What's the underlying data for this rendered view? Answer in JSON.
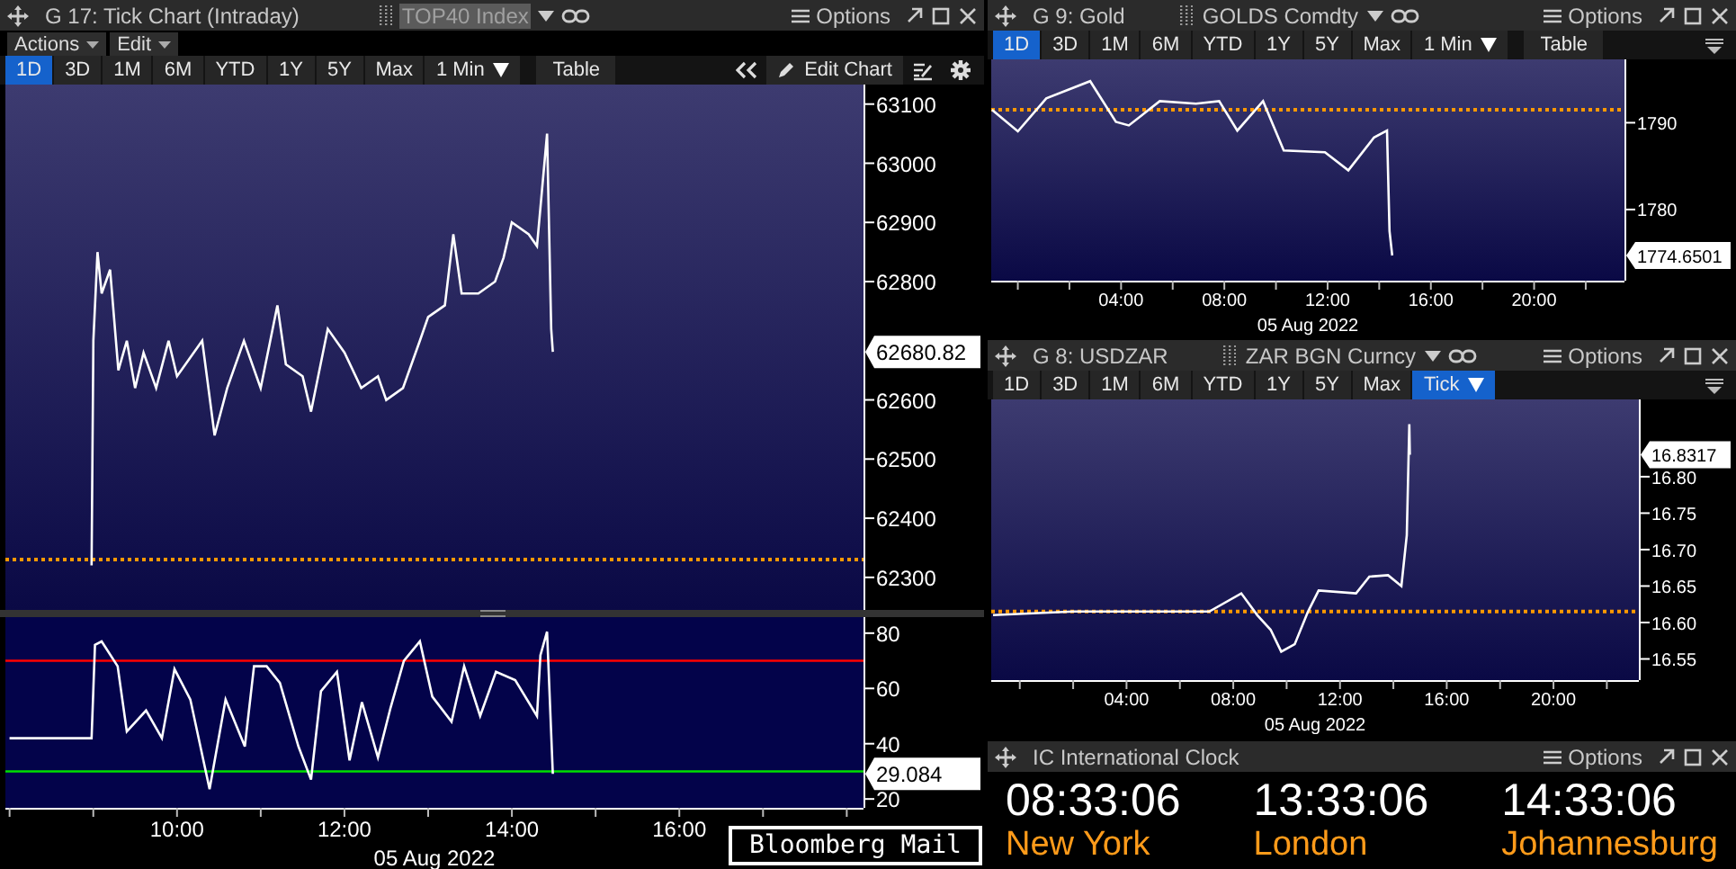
{
  "left_panel": {
    "title": "G 17: Tick Chart (Intraday)",
    "security": {
      "label": "TOP40 Index",
      "selected": true
    },
    "options": "Options",
    "menus": [
      {
        "label": "Actions"
      },
      {
        "label": "Edit"
      }
    ],
    "controls": [
      {
        "kind": "range",
        "label": "1D",
        "selected": true
      },
      {
        "kind": "range",
        "label": "3D",
        "selected": false
      },
      {
        "kind": "range",
        "label": "1M",
        "selected": false
      },
      {
        "kind": "range",
        "label": "6M",
        "selected": false
      },
      {
        "kind": "range",
        "label": "YTD",
        "selected": false
      },
      {
        "kind": "range",
        "label": "1Y",
        "selected": false
      },
      {
        "kind": "range",
        "label": "5Y",
        "selected": false
      },
      {
        "kind": "range",
        "label": "Max",
        "selected": false
      },
      {
        "kind": "interval",
        "label": "1 Min",
        "selected": false
      },
      {
        "kind": "button",
        "label": "Table",
        "selected": false
      }
    ],
    "edit_chart": "Edit Chart",
    "price_chart": {
      "chart_data": {
        "type": "line",
        "x": [
          8.98,
          9.0,
          9.05,
          9.1,
          9.2,
          9.3,
          9.4,
          9.5,
          9.6,
          9.75,
          9.9,
          10.0,
          10.1,
          10.3,
          10.45,
          10.6,
          10.8,
          11.0,
          11.2,
          11.3,
          11.5,
          11.6,
          11.8,
          12.0,
          12.2,
          12.4,
          12.5,
          12.7,
          12.9,
          13.0,
          13.2,
          13.3,
          13.4,
          13.6,
          13.8,
          13.9,
          14.0,
          14.2,
          14.3,
          14.42,
          14.47,
          14.49
        ],
        "series": [
          {
            "color": "#ffffff",
            "values": [
              62320,
              62700,
              62850,
              62780,
              62820,
              62650,
              62700,
              62620,
              62680,
              62620,
              62700,
              62640,
              62660,
              62700,
              62540,
              62620,
              62700,
              62620,
              62760,
              62660,
              62640,
              62580,
              62720,
              62680,
              62620,
              62640,
              62600,
              62620,
              62700,
              62740,
              62760,
              62880,
              62780,
              62780,
              62800,
              62840,
              62900,
              62880,
              62860,
              63050,
              62720,
              62681
            ]
          }
        ],
        "xlim": [
          7.95,
          18.2
        ],
        "ylim": [
          62245,
          63133
        ],
        "yticks": [
          62300,
          62400,
          62500,
          62600,
          62800,
          62900,
          63000,
          63100
        ],
        "ref_lines": [
          {
            "axis": "y",
            "value": 62330,
            "color": "#ff9900"
          }
        ]
      },
      "last_price": "62680.82"
    },
    "indicator_chart": {
      "chart_data": {
        "type": "line",
        "x": [
          8.0,
          8.98,
          9.02,
          9.1,
          9.29,
          9.4,
          9.63,
          9.82,
          9.97,
          10.16,
          10.39,
          10.58,
          10.81,
          10.92,
          11.07,
          11.23,
          11.45,
          11.6,
          11.72,
          11.91,
          12.06,
          12.21,
          12.4,
          12.55,
          12.71,
          12.9,
          13.05,
          13.28,
          13.43,
          13.62,
          13.81,
          14.04,
          14.3,
          14.34,
          14.42,
          14.49
        ],
        "series": [
          {
            "color": "#ffffff",
            "values": [
              42,
              42,
              75.8,
              77,
              68,
              44.4,
              52,
              42,
              67,
              56,
              23.6,
              56,
              39,
              68,
              68,
              62,
              39,
              27,
              59,
              66,
              34,
              55,
              35,
              53,
              70,
              77,
              57,
              48,
              68,
              50,
              66,
              63,
              50,
              72,
              80.5,
              29.1
            ]
          }
        ],
        "xlim": [
          7.95,
          18.2
        ],
        "ylim": [
          16.8,
          85.8
        ],
        "yticks": [
          20,
          40,
          60,
          80
        ],
        "xlabel": "05 Aug 2022",
        "xticks": [
          {
            "value": 10,
            "label": "10:00"
          },
          {
            "value": 12,
            "label": "12:00"
          },
          {
            "value": 14,
            "label": "14:00"
          },
          {
            "value": 16,
            "label": "16:00"
          }
        ],
        "ref_lines": [
          {
            "axis": "y",
            "value": 70,
            "color": "#ff0000"
          },
          {
            "axis": "y",
            "value": 30,
            "color": "#00e000"
          }
        ]
      },
      "last_price": "29.084"
    },
    "footer_button": "Bloomberg Mail"
  },
  "gold_panel": {
    "title": "G 9: Gold",
    "security": {
      "label": "GOLDS Comdty",
      "selected": false
    },
    "options": "Options",
    "controls": [
      {
        "kind": "range",
        "label": "1D",
        "selected": true
      },
      {
        "kind": "range",
        "label": "3D",
        "selected": false
      },
      {
        "kind": "range",
        "label": "1M",
        "selected": false
      },
      {
        "kind": "range",
        "label": "6M",
        "selected": false
      },
      {
        "kind": "range",
        "label": "YTD",
        "selected": false
      },
      {
        "kind": "range",
        "label": "1Y",
        "selected": false
      },
      {
        "kind": "range",
        "label": "5Y",
        "selected": false
      },
      {
        "kind": "range",
        "label": "Max",
        "selected": false
      },
      {
        "kind": "interval",
        "label": "1 Min",
        "selected": false
      },
      {
        "kind": "button",
        "label": "Table",
        "selected": false
      }
    ],
    "chart_data": {
      "type": "line",
      "x": [
        -1.0,
        0.0,
        1.1,
        2.8,
        3.8,
        4.3,
        5.5,
        6.9,
        7.8,
        8.5,
        9.5,
        10.3,
        11.9,
        12.8,
        13.8,
        14.3,
        14.4,
        14.5
      ],
      "series": [
        {
          "color": "#ffffff",
          "values": [
            1791.5,
            1789,
            1792.8,
            1794.8,
            1790.1,
            1789.7,
            1792.5,
            1792.2,
            1792.5,
            1789.1,
            1792.5,
            1786.8,
            1786.6,
            1784.5,
            1788.3,
            1789.1,
            1777.5,
            1774.7
          ]
        }
      ],
      "xlim": [
        -1.03,
        23.5
      ],
      "ylim": [
        1771.8,
        1797.3
      ],
      "yticks": [
        1780,
        1790
      ],
      "xlabel": "05 Aug 2022",
      "xticks": [
        {
          "value": 4,
          "label": "04:00"
        },
        {
          "value": 8,
          "label": "08:00"
        },
        {
          "value": 12,
          "label": "12:00"
        },
        {
          "value": 16,
          "label": "16:00"
        },
        {
          "value": 20,
          "label": "20:00"
        }
      ],
      "ref_lines": [
        {
          "axis": "y",
          "value": 1791.5,
          "color": "#ff9900"
        }
      ]
    },
    "last_price": "1774.6501"
  },
  "usdzar_panel": {
    "title": "G 8: USDZAR",
    "security": {
      "label": "ZAR BGN Curncy",
      "selected": false
    },
    "options": "Options",
    "controls": [
      {
        "kind": "range",
        "label": "1D",
        "selected": false
      },
      {
        "kind": "range",
        "label": "3D",
        "selected": false
      },
      {
        "kind": "range",
        "label": "1M",
        "selected": false
      },
      {
        "kind": "range",
        "label": "6M",
        "selected": false
      },
      {
        "kind": "range",
        "label": "YTD",
        "selected": false
      },
      {
        "kind": "range",
        "label": "1Y",
        "selected": false
      },
      {
        "kind": "range",
        "label": "5Y",
        "selected": false
      },
      {
        "kind": "range",
        "label": "Max",
        "selected": false
      },
      {
        "kind": "interval",
        "label": "Tick",
        "selected": true
      }
    ],
    "chart_data": {
      "type": "line",
      "x": [
        -1.0,
        2.0,
        4.9,
        7.1,
        8.3,
        8.9,
        9.4,
        9.8,
        10.3,
        10.8,
        11.2,
        12.6,
        13.1,
        13.8,
        14.3,
        14.5,
        14.6,
        14.62
      ],
      "series": [
        {
          "color": "#ffffff",
          "values": [
            16.61,
            16.615,
            16.615,
            16.615,
            16.64,
            16.61,
            16.59,
            16.56,
            16.57,
            16.615,
            16.644,
            16.64,
            16.663,
            16.665,
            16.65,
            16.72,
            16.872,
            16.83
          ]
        }
      ],
      "xlim": [
        -1.07,
        23.2
      ],
      "ylim": [
        16.521,
        16.906
      ],
      "yticks": [
        {
          "value": 16.55,
          "label": "16.55"
        },
        {
          "value": 16.6,
          "label": "16.60"
        },
        {
          "value": 16.65,
          "label": "16.65"
        },
        {
          "value": 16.7,
          "label": "16.70"
        },
        {
          "value": 16.75,
          "label": "16.75"
        },
        {
          "value": 16.8,
          "label": "16.80"
        }
      ],
      "xlabel": "05 Aug 2022",
      "xticks": [
        {
          "value": 4,
          "label": "04:00"
        },
        {
          "value": 8,
          "label": "08:00"
        },
        {
          "value": 12,
          "label": "12:00"
        },
        {
          "value": 16,
          "label": "16:00"
        },
        {
          "value": 20,
          "label": "20:00"
        }
      ],
      "ref_lines": [
        {
          "axis": "y",
          "value": 16.615,
          "color": "#ff9900"
        }
      ]
    },
    "last_price": "16.8317"
  },
  "clock_panel": {
    "title": "IC International Clock",
    "options": "Options",
    "clocks": [
      {
        "time": "08:33:06",
        "city": "New York"
      },
      {
        "time": "13:33:06",
        "city": "London"
      },
      {
        "time": "14:33:06",
        "city": "Johannesburg"
      }
    ]
  }
}
